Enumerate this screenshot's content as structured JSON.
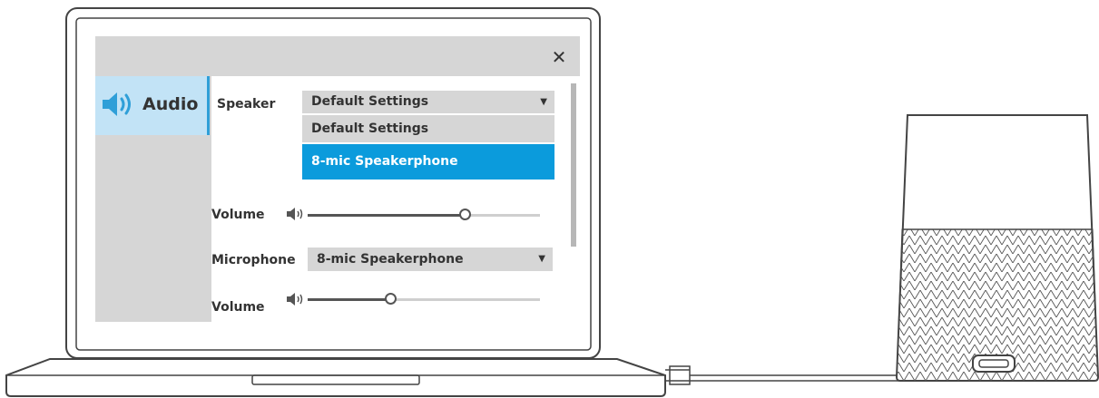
{
  "dialog": {
    "close_glyph": "✕",
    "sidebar": {
      "tab_label": "Audio",
      "tab_icon": "speaker-icon"
    },
    "speaker": {
      "label": "Speaker",
      "selected": "Default Settings",
      "options": [
        "Default Settings",
        "8-mic Speakerphone"
      ],
      "highlighted_index": 1
    },
    "speaker_volume": {
      "label": "Volume",
      "level": 0.68
    },
    "microphone": {
      "label": "Microphone",
      "selected": "8-mic Speakerphone"
    },
    "mic_volume": {
      "label": "Volume",
      "level": 0.36
    }
  },
  "colors": {
    "highlight": "#0b9bdc",
    "tab_bg": "#c2e3f6",
    "tab_border": "#2f9fd8",
    "panel_gray": "#d6d6d6"
  }
}
